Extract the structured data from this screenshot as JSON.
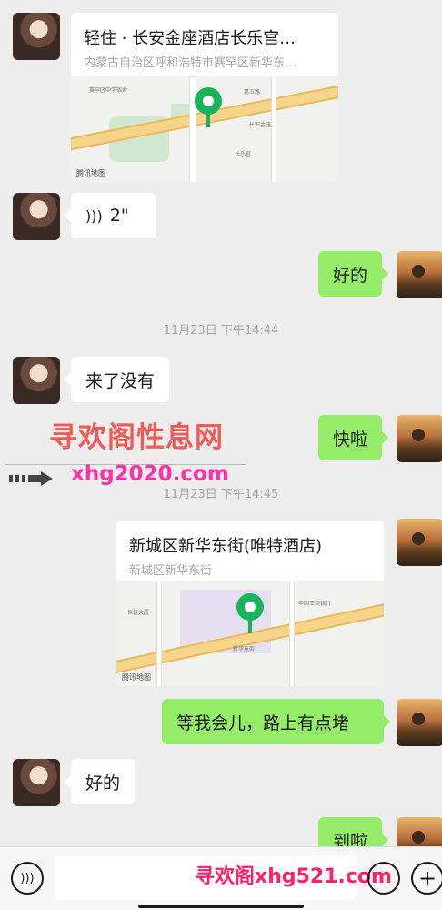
{
  "messages": {
    "location1": {
      "title": "轻住 · 长安金座酒店长乐宫…",
      "address": "内蒙古自治区呼和浩特市赛罕区新华东…",
      "map_logo": "腾讯地图"
    },
    "voice1": {
      "duration": "2\""
    },
    "me1": {
      "text": "好的"
    },
    "time1": "11月23日 下午14:44",
    "her2": {
      "text": "来了没有"
    },
    "me2": {
      "text": "快啦"
    },
    "time2": "11月23日 下午14:45",
    "location2": {
      "title": "新城区新华东街(唯特酒店)",
      "address": "新城区新华东街",
      "map_logo": "腾讯地图"
    },
    "me3": {
      "text": "等我会儿，路上有点堵"
    },
    "her3": {
      "text": "好的"
    },
    "me4": {
      "text": "到啦"
    }
  },
  "watermarks": {
    "line1": "寻欢阁性息网",
    "line2": "xhg2020.com",
    "line3": "寻欢阁xhg521.com"
  },
  "icons": {
    "voice": "voice-wave-icon",
    "emoji": "emoji-icon",
    "plus": "plus-icon",
    "map_pin": "map-pin-icon"
  },
  "colors": {
    "bubble_green": "#95ec69",
    "pin_green": "#19b35e",
    "watermark_red": "#f05a57",
    "watermark_pink": "#ff2fa8"
  }
}
